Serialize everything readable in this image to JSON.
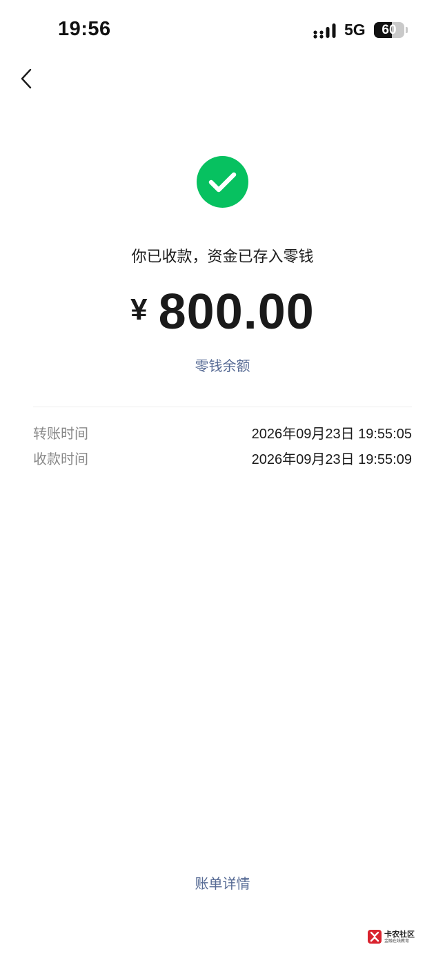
{
  "status_bar": {
    "time": "19:56",
    "network": "5G",
    "battery_level": "60",
    "battery_fraction": 0.6
  },
  "icons": {
    "back": "chevron-left-icon",
    "success": "check-circle-icon",
    "signal": "signal-icon"
  },
  "colors": {
    "success_green": "#07c160",
    "link_blue": "#576b95",
    "label_gray": "#888888"
  },
  "receipt": {
    "headline": "你已收款，资金已存入零钱",
    "currency": "¥",
    "amount": "800.00",
    "balance_link": "零钱余额"
  },
  "details": [
    {
      "label": "转账时间",
      "value": "2026年09月23日 19:55:05"
    },
    {
      "label": "收款时间",
      "value": "2026年09月23日 19:55:09"
    }
  ],
  "footer": {
    "bill_details": "账单详情"
  },
  "watermark": {
    "title": "卡农社区",
    "subtitle": "金融在线教育"
  }
}
